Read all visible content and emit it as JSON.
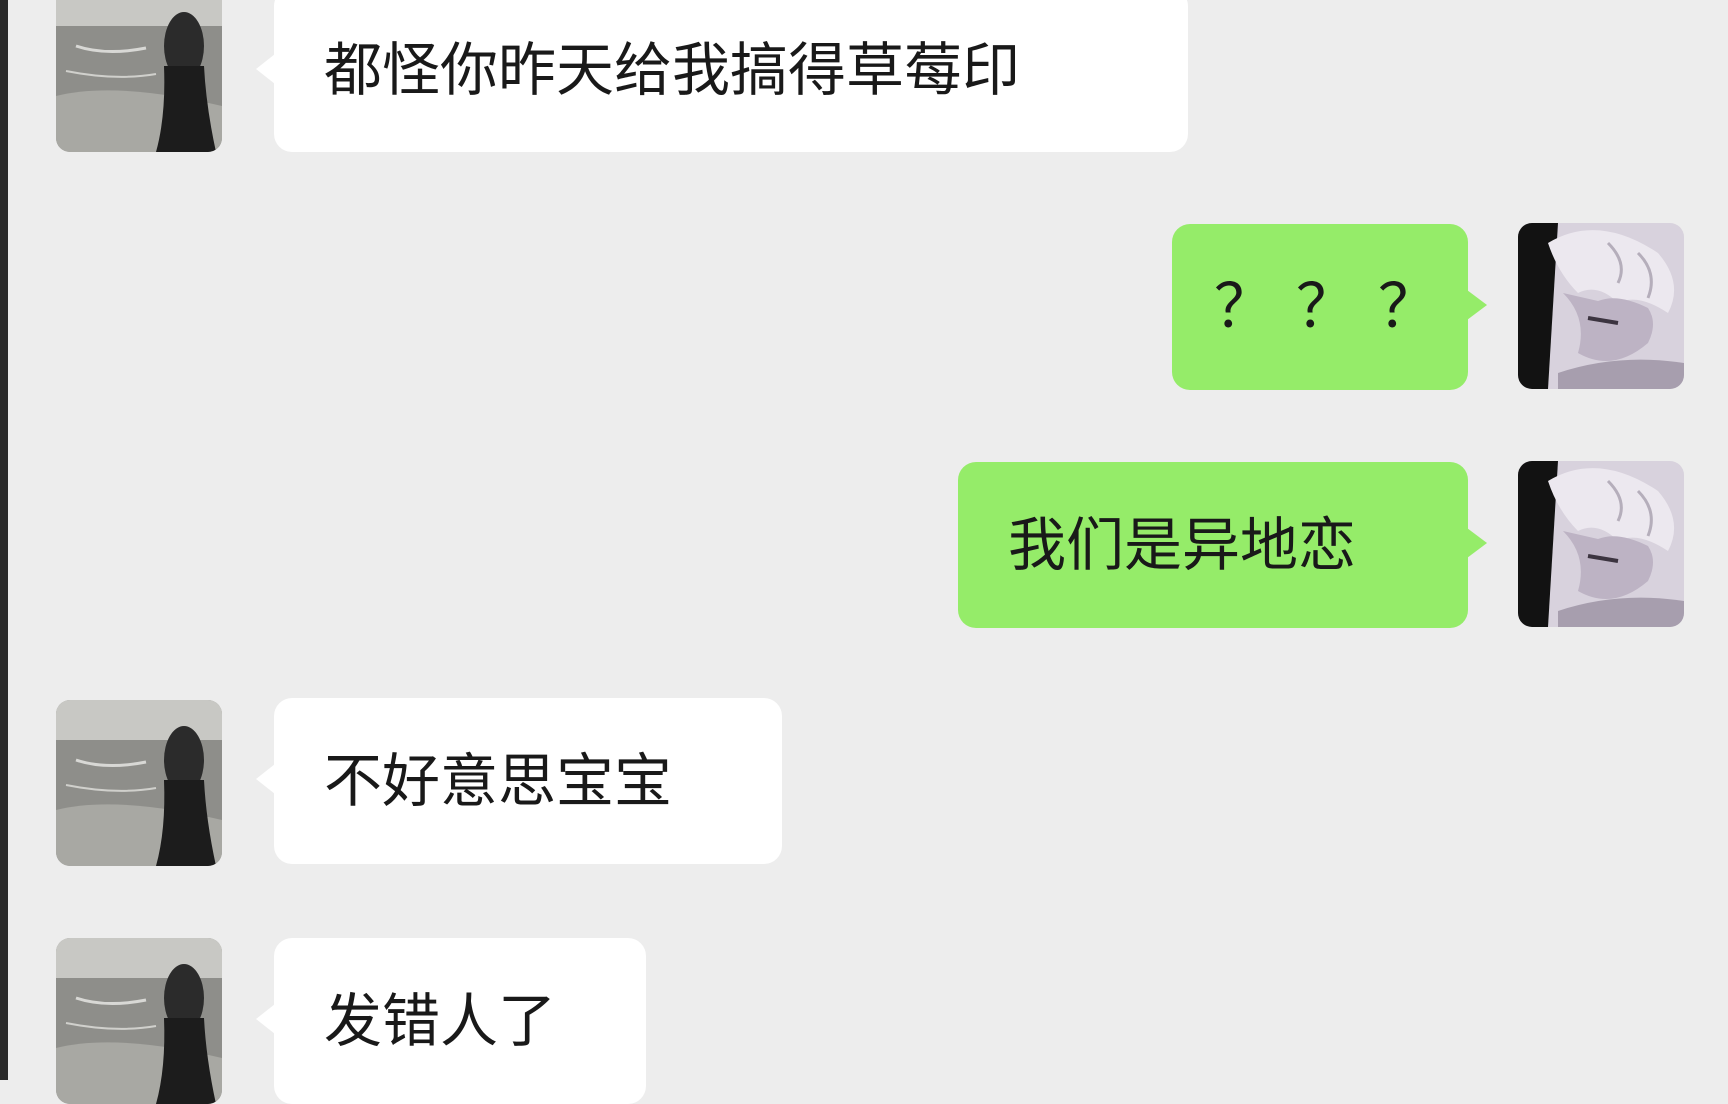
{
  "chat": {
    "messages": [
      {
        "sender": "contact",
        "text": "都怪你昨天给我搞得草莓印"
      },
      {
        "sender": "me",
        "text": "？？？"
      },
      {
        "sender": "me",
        "text": "我们是异地恋"
      },
      {
        "sender": "contact",
        "text": "不好意思宝宝"
      },
      {
        "sender": "contact",
        "text": "发错人了"
      }
    ]
  },
  "colors": {
    "background": "#ededed",
    "incoming_bubble": "#ffffff",
    "outgoing_bubble": "#95ec69",
    "text": "#191919"
  },
  "avatars": {
    "contact": "photo-avatar-girl-at-beach",
    "me": "anime-avatar-white-hair"
  }
}
